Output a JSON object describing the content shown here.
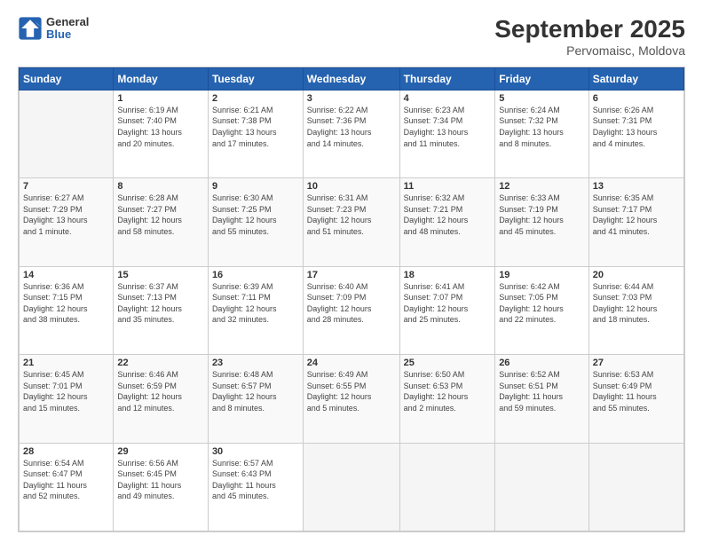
{
  "header": {
    "logo_line1": "General",
    "logo_line2": "Blue",
    "month_year": "September 2025",
    "location": "Pervomaisc, Moldova"
  },
  "days_of_week": [
    "Sunday",
    "Monday",
    "Tuesday",
    "Wednesday",
    "Thursday",
    "Friday",
    "Saturday"
  ],
  "weeks": [
    [
      {
        "day": "",
        "info": ""
      },
      {
        "day": "1",
        "info": "Sunrise: 6:19 AM\nSunset: 7:40 PM\nDaylight: 13 hours\nand 20 minutes."
      },
      {
        "day": "2",
        "info": "Sunrise: 6:21 AM\nSunset: 7:38 PM\nDaylight: 13 hours\nand 17 minutes."
      },
      {
        "day": "3",
        "info": "Sunrise: 6:22 AM\nSunset: 7:36 PM\nDaylight: 13 hours\nand 14 minutes."
      },
      {
        "day": "4",
        "info": "Sunrise: 6:23 AM\nSunset: 7:34 PM\nDaylight: 13 hours\nand 11 minutes."
      },
      {
        "day": "5",
        "info": "Sunrise: 6:24 AM\nSunset: 7:32 PM\nDaylight: 13 hours\nand 8 minutes."
      },
      {
        "day": "6",
        "info": "Sunrise: 6:26 AM\nSunset: 7:31 PM\nDaylight: 13 hours\nand 4 minutes."
      }
    ],
    [
      {
        "day": "7",
        "info": "Sunrise: 6:27 AM\nSunset: 7:29 PM\nDaylight: 13 hours\nand 1 minute."
      },
      {
        "day": "8",
        "info": "Sunrise: 6:28 AM\nSunset: 7:27 PM\nDaylight: 12 hours\nand 58 minutes."
      },
      {
        "day": "9",
        "info": "Sunrise: 6:30 AM\nSunset: 7:25 PM\nDaylight: 12 hours\nand 55 minutes."
      },
      {
        "day": "10",
        "info": "Sunrise: 6:31 AM\nSunset: 7:23 PM\nDaylight: 12 hours\nand 51 minutes."
      },
      {
        "day": "11",
        "info": "Sunrise: 6:32 AM\nSunset: 7:21 PM\nDaylight: 12 hours\nand 48 minutes."
      },
      {
        "day": "12",
        "info": "Sunrise: 6:33 AM\nSunset: 7:19 PM\nDaylight: 12 hours\nand 45 minutes."
      },
      {
        "day": "13",
        "info": "Sunrise: 6:35 AM\nSunset: 7:17 PM\nDaylight: 12 hours\nand 41 minutes."
      }
    ],
    [
      {
        "day": "14",
        "info": "Sunrise: 6:36 AM\nSunset: 7:15 PM\nDaylight: 12 hours\nand 38 minutes."
      },
      {
        "day": "15",
        "info": "Sunrise: 6:37 AM\nSunset: 7:13 PM\nDaylight: 12 hours\nand 35 minutes."
      },
      {
        "day": "16",
        "info": "Sunrise: 6:39 AM\nSunset: 7:11 PM\nDaylight: 12 hours\nand 32 minutes."
      },
      {
        "day": "17",
        "info": "Sunrise: 6:40 AM\nSunset: 7:09 PM\nDaylight: 12 hours\nand 28 minutes."
      },
      {
        "day": "18",
        "info": "Sunrise: 6:41 AM\nSunset: 7:07 PM\nDaylight: 12 hours\nand 25 minutes."
      },
      {
        "day": "19",
        "info": "Sunrise: 6:42 AM\nSunset: 7:05 PM\nDaylight: 12 hours\nand 22 minutes."
      },
      {
        "day": "20",
        "info": "Sunrise: 6:44 AM\nSunset: 7:03 PM\nDaylight: 12 hours\nand 18 minutes."
      }
    ],
    [
      {
        "day": "21",
        "info": "Sunrise: 6:45 AM\nSunset: 7:01 PM\nDaylight: 12 hours\nand 15 minutes."
      },
      {
        "day": "22",
        "info": "Sunrise: 6:46 AM\nSunset: 6:59 PM\nDaylight: 12 hours\nand 12 minutes."
      },
      {
        "day": "23",
        "info": "Sunrise: 6:48 AM\nSunset: 6:57 PM\nDaylight: 12 hours\nand 8 minutes."
      },
      {
        "day": "24",
        "info": "Sunrise: 6:49 AM\nSunset: 6:55 PM\nDaylight: 12 hours\nand 5 minutes."
      },
      {
        "day": "25",
        "info": "Sunrise: 6:50 AM\nSunset: 6:53 PM\nDaylight: 12 hours\nand 2 minutes."
      },
      {
        "day": "26",
        "info": "Sunrise: 6:52 AM\nSunset: 6:51 PM\nDaylight: 11 hours\nand 59 minutes."
      },
      {
        "day": "27",
        "info": "Sunrise: 6:53 AM\nSunset: 6:49 PM\nDaylight: 11 hours\nand 55 minutes."
      }
    ],
    [
      {
        "day": "28",
        "info": "Sunrise: 6:54 AM\nSunset: 6:47 PM\nDaylight: 11 hours\nand 52 minutes."
      },
      {
        "day": "29",
        "info": "Sunrise: 6:56 AM\nSunset: 6:45 PM\nDaylight: 11 hours\nand 49 minutes."
      },
      {
        "day": "30",
        "info": "Sunrise: 6:57 AM\nSunset: 6:43 PM\nDaylight: 11 hours\nand 45 minutes."
      },
      {
        "day": "",
        "info": ""
      },
      {
        "day": "",
        "info": ""
      },
      {
        "day": "",
        "info": ""
      },
      {
        "day": "",
        "info": ""
      }
    ]
  ]
}
